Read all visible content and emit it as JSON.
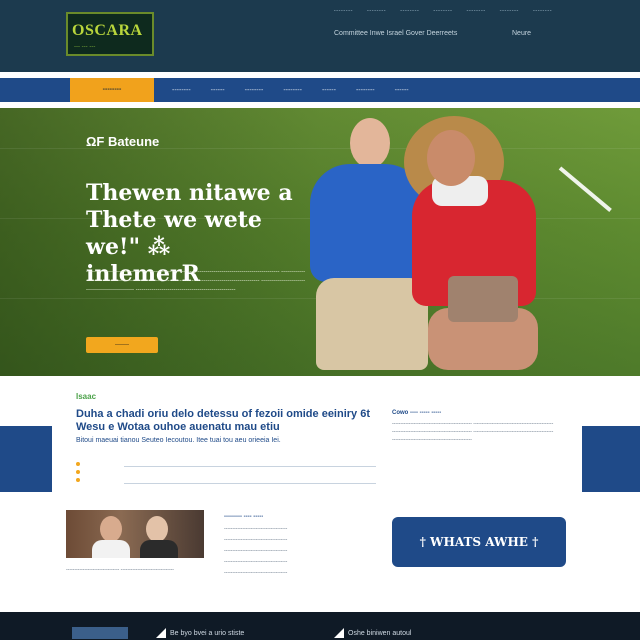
{
  "header": {
    "logo_text": "OSCARA",
    "logo_sub": "--- --- ---",
    "utility_links": [
      "--------",
      "--------",
      "--------",
      "--------",
      "--------",
      "--------",
      "--------"
    ],
    "tagline": "Committee Inwe Israel Gover Deerreets",
    "tagline_right": "Neure"
  },
  "nav": {
    "items": [
      "--------",
      "--------",
      "------",
      "--------",
      "--------",
      "------",
      "--------",
      "------"
    ]
  },
  "hero": {
    "kicker": "ΩF Bateune",
    "title_line1": "Thewen nitawe a",
    "title_line2": "Thete we wete we!\" ⁂",
    "title_line3": "inlemerR",
    "body": "-------------------------------------------------- ---------------------------------------------- -------------------------------------------------- ------------------------------------------------ ---------------------------------------------- --------------------------------------------------",
    "button": "-------"
  },
  "intro": {
    "label": "Isaac",
    "headline": "Duha a chadi oriu delo detessu of fezoii omide eeiniry 6t Wesu e Wotaa ouhoe auenatu mau etiu",
    "small": "Bitoui maeuai tianou Seuteo Iecoutou. Itee tuai tou aeu orieeia Iei.",
    "right_head": "Cowo ---- ----- -----",
    "right_body": "------------------------------------------------ ------------------------------------------------ ------------------------------------------------ ------------------------------------------------ ------------------------------------------------"
  },
  "lower": {
    "photo_caption": "-------------------------------- --------------------------------",
    "mid_head": "--------- ---- -----",
    "mid_lines": [
      "--------------------------------------",
      "--------------------------------------",
      "--------------------------------------",
      "--------------------------------------",
      "--------------------------------------"
    ],
    "cta_label": "† WHATS AWHE †"
  },
  "footer": {
    "item1": "Be byo bvei a urio stiste",
    "item2": "Oshe biniwen autoul"
  },
  "colors": {
    "header_bg": "#1c3a4e",
    "nav_bg": "#1f4a88",
    "accent": "#f2a71e",
    "hero_green": "#5e8b30",
    "label_green": "#4ca24a",
    "footer_bg": "#0f1a26"
  }
}
